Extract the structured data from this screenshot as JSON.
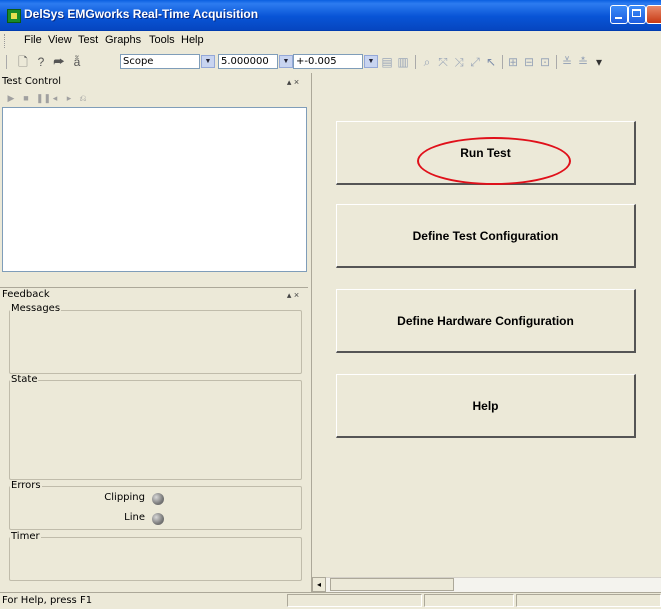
{
  "window": {
    "title": "DelSys EMGworks Real-Time Acquisition"
  },
  "menu": [
    "File",
    "View",
    "Test",
    "Graphs",
    "Tools",
    "Help"
  ],
  "toolbar": {
    "mode_value": "Scope",
    "time_value": "5.000000",
    "range_value": "+-0.005"
  },
  "test_control": {
    "title": "Test Control",
    "controls": "▴ ×"
  },
  "feedback": {
    "title": "Feedback",
    "controls": "▴ ×",
    "messages_label": "Messages",
    "state_label": "State",
    "errors_label": "Errors",
    "clipping_label": "Clipping",
    "line_label": "Line",
    "timer_label": "Timer"
  },
  "actions": {
    "run_test": "Run Test",
    "define_test": "Define Test Configuration",
    "define_hardware": "Define Hardware Configuration",
    "help": "Help"
  },
  "status": {
    "text": "For Help, press F1"
  },
  "colors": {
    "titlebar": "#0a5fe0",
    "annotation": "#e0101a"
  }
}
